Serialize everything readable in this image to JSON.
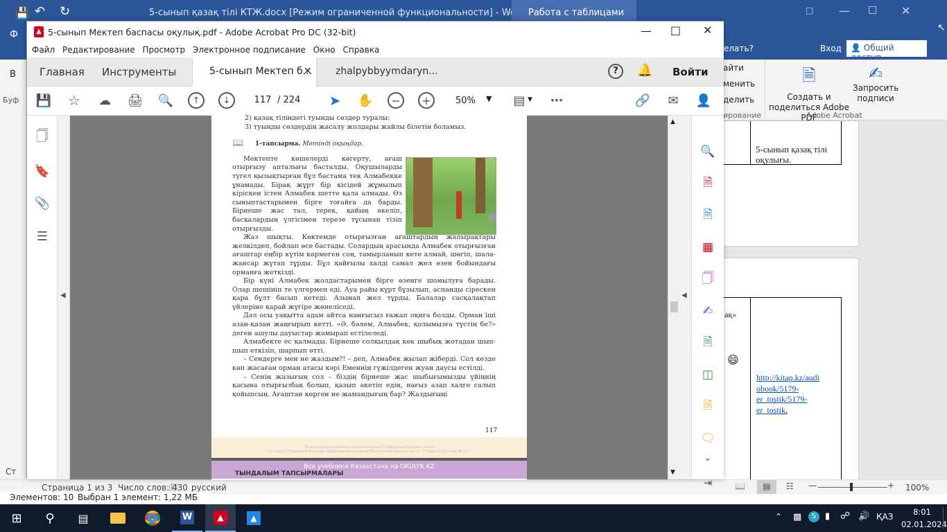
{
  "word": {
    "title": "5-сынып қазақ тілі КТЖ.docx [Режим ограниченной функциональности] - Word",
    "tools_tab": "Работа с таблицами",
    "tell_me": "елать?",
    "login": "Вход",
    "share": "Общий доступ",
    "ribbon_frag1": "айти",
    "ribbon_frag2": "менить",
    "ribbon_frag3": "делить",
    "ribbon_frag4": "ирование",
    "create_pdf": "Создать и поделиться Adobe PDF",
    "request_sign": "Запросить подписи",
    "adobe_group": "Adobe Acrobat",
    "cell_text1": "5-сынып қазақ тілі оқулығы.",
    "cell_frag": "ақ»",
    "link": "http://kitap.kz/audiobook/5179-er_tostik/5179-er_tostik",
    "link_parts": [
      "http://kitap.kz/audi",
      "obook/5179-",
      "er_tostik/5179-",
      "er_tostik"
    ],
    "left_frag1": "В",
    "left_frag2": "Буф",
    "left_frag3": "Ст",
    "status": {
      "page": "Страница 1 из 3",
      "words": "Число слов: 430",
      "lang": "русский",
      "zoom": "100%"
    },
    "explorer_status": {
      "items": "Элементов: 10",
      "selected": "Выбран 1 элемент: 1,22 МБ"
    }
  },
  "acrobat": {
    "title": "5-сынып Мектеп баспасы оқулық.pdf - Adobe Acrobat Pro DC (32-bit)",
    "menu": [
      "Файл",
      "Редактирование",
      "Просмотр",
      "Электронное подписание",
      "Окно",
      "Справка"
    ],
    "tabs": {
      "home": "Главная",
      "tools": "Инструменты",
      "doc1": "5-сынып Мектеп б...",
      "doc2": "zhalpybbyymdaryn...",
      "signin": "Войти"
    },
    "toolbar": {
      "page_current": "117",
      "page_total": "/  224",
      "zoom": "50%"
    }
  },
  "pdf": {
    "top_lines": [
      "2) қазақ тіліндегі туынды сөздер туралы;",
      "3) туынды сөздердің жасалу жолдары жайлы білетін боламыз."
    ],
    "task_label": "1-тапсырма.",
    "task_text": "Мәтінді оқыңдар.",
    "paragraphs": [
      "Мектепте көшелерді көгерту, ағаш отырғызу апталығы басталды. Оқушыларды түгел қызықтырған бұл бастама тек Алмабекке ұнамады. Бірақ жұрт бір кісідей жұмылып кіріскен істен Алмабек шетте қала алмады. Өз сыныптастарымен бірге тоғайға да барды. Бірнеше жас тал, терек, қайың әкеліп, басқалардың үлгісімен терезе тұсынан тізіп отырғызды.",
      "Жаз шықты. Көктемде отырғызған ағаштардың жапырақтары желкілдеп, бойлап өсе бастады. Солардың арасында Алмабек отырғызған ағаштар еңбір күтім көрмеген соң, тамырланып кете алмай, шөгіп, шала-жансар жүтап тұрды. Бұл қайғылы халді самал жел өзен бойындағы орманға жеткізді.",
      "Бір күні Алмабек жолдастарымен бірге өзенге шомылуға барады. Олар шешініп те үлгермеп еді. Ауа райы күрт бұзылып, аспанды сірескен қара бұлт басып кетеді. Азынап жел тұрды. Балалар сасқалақтап үйлеріне қарай жүгіре жөнеліседі.",
      "Дәл осы уақытта адам айтса нанғысыз ғажап оқиға болды. Орман іші азан-қазан жаңғырып кетті. «Ә, бәлем, Алмабек, қолымызға түстің бе?» деген ашулы дауыстар жамырап естілеледі.",
      "Алмабекте ес қалмады. Бірнеше солқылдақ көк шыбық жотадан шып-шып еткізіп, шарпып өтті.",
      "– Сендерге мен не жаздым?! – деп, Алмабек жылап жіберді. Сол кезде көп жасаған орман атасы кәрі Еменнің гүжілдеген жуан даусы естілді.",
      "– Сенің жазығың сол – біздің бірнеше жас шыбығымызды үйіңнің қасына отырғызбақ болып, қазып әкетіп едің, нағыз азап халге салып қойыпсың. Ағаштан көрген не жамандығың бар? Жаздығыңі"
    ],
    "page_number": "117",
    "footer1": "*Книга предоставлена исключительно в образовательных целях",
    "footer2": "согласно Приказа Министра образования и науки Республики Казахстан от 17 мая 2019 года № 217",
    "footer_site": "Все учебники Казахстана на OKULYK.KZ",
    "bottom_frag": "ТЫНДАЛЫМ ТАПСЫРМАЛАРЫ"
  },
  "taskbar": {
    "lang": "ҚАЗ",
    "time": "8:01",
    "date": "02.01.2024"
  },
  "colors": {
    "word_blue": "#2b579a",
    "acrobat_red": "#d6001c",
    "taskbar": "#0f1a2a"
  }
}
